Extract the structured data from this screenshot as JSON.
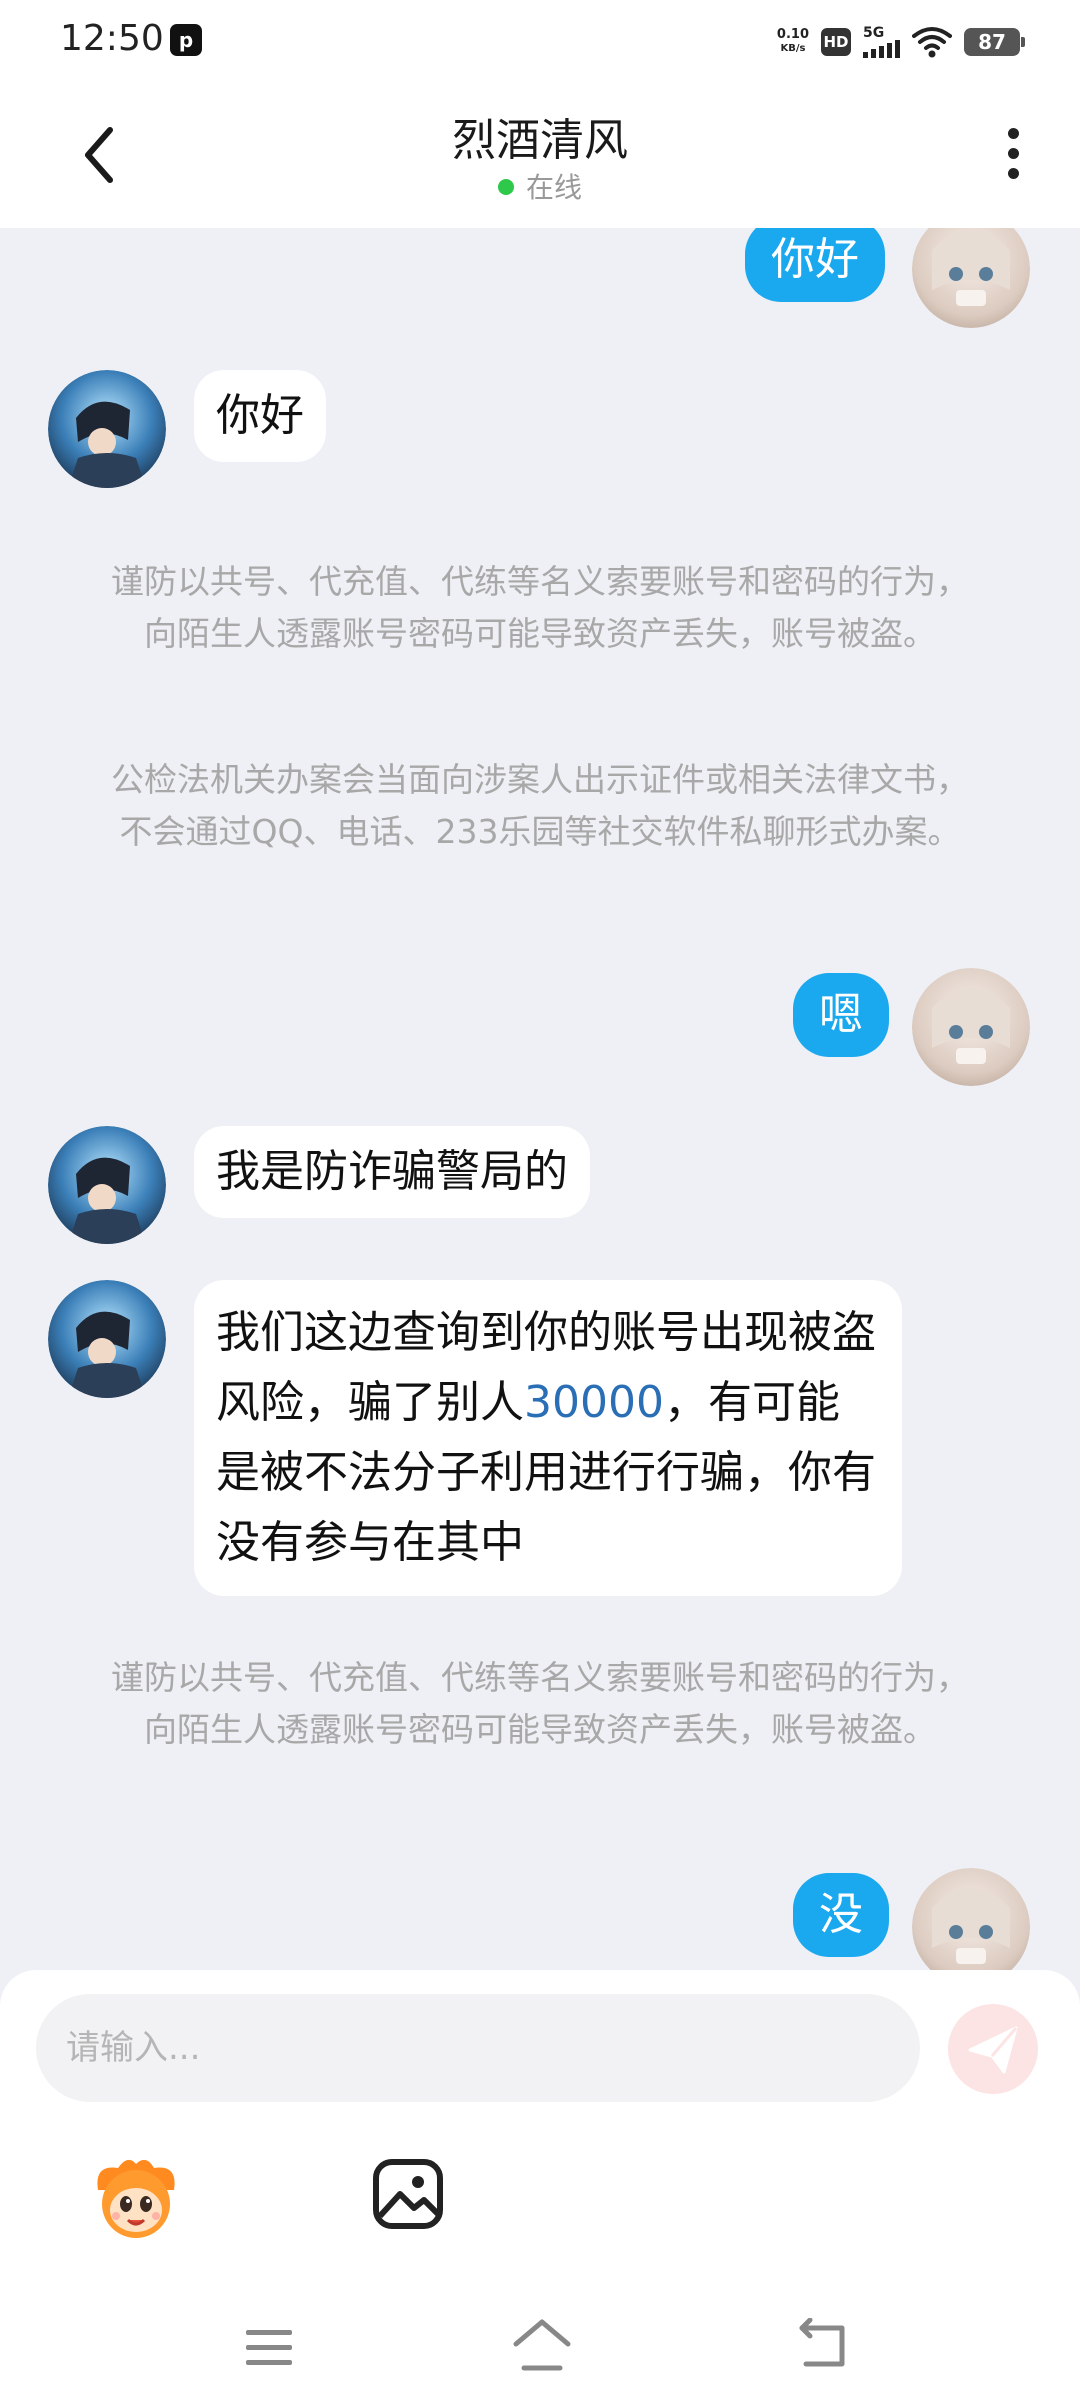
{
  "status_bar": {
    "time": "12:50",
    "net_speed_value": "0.10",
    "net_speed_unit": "KB/s",
    "hd": "HD",
    "network": "5G",
    "battery": "87"
  },
  "header": {
    "title": "烈酒清风",
    "status": "在线",
    "status_color": "#2ec84a"
  },
  "messages": [
    {
      "side": "out",
      "text": "你好"
    },
    {
      "side": "in",
      "text": "你好"
    },
    {
      "side": "notice",
      "text": "谨防以共号、代充值、代练等名义索要账号和密码的行为，向陌生人透露账号密码可能导致资产丢失，账号被盗。"
    },
    {
      "side": "notice",
      "text": "公检法机关办案会当面向涉案人出示证件或相关法律文书，不会通过QQ、电话、233乐园等社交软件私聊形式办案。"
    },
    {
      "side": "out",
      "text": "嗯"
    },
    {
      "side": "in",
      "text": "我是防诈骗警局的"
    },
    {
      "side": "in",
      "text_before": "我们这边查询到你的账号出现被盗风险，骗了别人",
      "text_number": "30000",
      "text_after": "，有可能是被不法分子利用进行行骗，你有没有参与在其中"
    },
    {
      "side": "notice",
      "text": "谨防以共号、代充值、代练等名义索要账号和密码的行为，向陌生人透露账号密码可能导致资产丢失，账号被盗。"
    },
    {
      "side": "out",
      "text": "没"
    }
  ],
  "input": {
    "placeholder": "请输入..."
  },
  "colors": {
    "outgoing_bubble": "#1aa8ef",
    "background": "#eef0f5",
    "notice_text": "#a8a8a8",
    "highlight_number": "#2a6fb5"
  },
  "icons": [
    "back-arrow-icon",
    "more-icon",
    "send-icon",
    "emoji-mascot-icon",
    "image-icon",
    "menu-icon",
    "home-icon",
    "back-icon"
  ]
}
